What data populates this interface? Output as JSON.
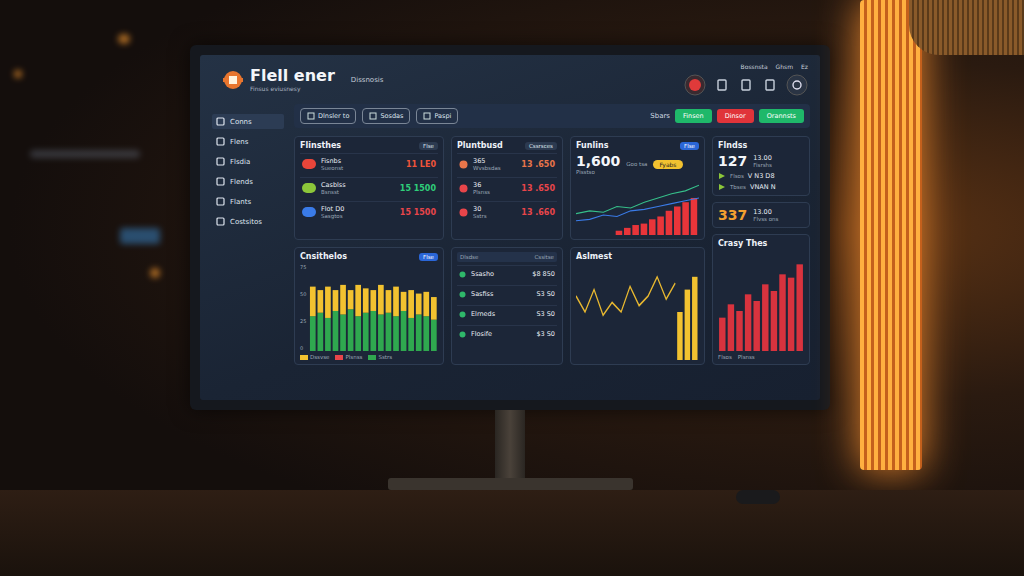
{
  "app": {
    "title": "Flell ener",
    "subtitle": "Finsus eviusnesy",
    "nav": "Dissnosis"
  },
  "top_links": [
    "Bossnsta",
    "Ghsm",
    "Ez"
  ],
  "sidebar": {
    "items": [
      {
        "label": "Conns",
        "selected": true
      },
      {
        "label": "Flens",
        "selected": false
      },
      {
        "label": "Flsdia",
        "selected": false
      },
      {
        "label": "Flends",
        "selected": false
      },
      {
        "label": "Flants",
        "selected": false
      },
      {
        "label": "Costsitos",
        "selected": false
      }
    ]
  },
  "toolbar": {
    "tabs": [
      "Dlnsler to",
      "Sosdas",
      "Paspi"
    ],
    "label": "Sbars",
    "actions": [
      {
        "label": "Finsen",
        "color": "#1fb86a"
      },
      {
        "label": "Dinsor",
        "color": "#e0343a"
      },
      {
        "label": "Orannsts",
        "color": "#1fb86a"
      }
    ]
  },
  "flinsthes": {
    "title": "Flinsthes",
    "badge": "Flse",
    "rows": [
      {
        "name": "Fisnbs",
        "sub": "Sueonst",
        "value": "11 LE0",
        "color": "#f0543a",
        "logo_color": "#e8453a"
      },
      {
        "name": "Casblss",
        "sub": "Bsnsst",
        "value": "15 1500",
        "color": "#2fce7a",
        "logo_color": "#8cc63a"
      },
      {
        "name": "Flot D0",
        "sub": "Sasgtos",
        "value": "15 1500",
        "color": "#e8454a",
        "logo_color": "#3a7be8"
      }
    ]
  },
  "pluntbusd": {
    "title": "Pluntbusd",
    "badge": "Cssrsces",
    "rows": [
      {
        "name": "365",
        "sub": "Wvsbsdas",
        "value": "13 .650",
        "color": "#e8754a"
      },
      {
        "name": "36",
        "sub": "Plsnss",
        "value": "13 .650",
        "color": "#e8454a"
      },
      {
        "name": "30",
        "sub": "Sstrs",
        "value": "13 .660",
        "color": "#e8454a"
      }
    ]
  },
  "funlins": {
    "title": "Funlins",
    "badge": "Flse",
    "value": "1,600",
    "sub": "Pisstso",
    "note": "Goo tsa",
    "pill": "Fyabs",
    "max": 80,
    "line_a": [
      30,
      34,
      32,
      40,
      38,
      46,
      52,
      58,
      62,
      70
    ],
    "line_b": [
      20,
      22,
      28,
      26,
      34,
      36,
      40,
      44,
      48,
      52
    ],
    "bars": [
      6,
      10,
      14,
      16,
      22,
      26,
      34,
      40,
      46,
      52
    ]
  },
  "flndss": {
    "title": "Flndss",
    "value": "127",
    "sub": "13.00",
    "caption": "Fisrshs",
    "rows": [
      {
        "label": "Flsos",
        "value": "V N3 D8"
      },
      {
        "label": "Tbses",
        "value": "VNAN N"
      }
    ]
  },
  "stat": {
    "value": "337",
    "sub": "13.00",
    "caption": "Flvss ons"
  },
  "crasy": {
    "title": "Crasy Thes",
    "max": 60,
    "values": [
      20,
      28,
      24,
      34,
      30,
      40,
      36,
      46,
      44,
      52
    ],
    "legend": [
      "Flsos",
      "Plsnss"
    ]
  },
  "cnsithelos": {
    "title": "Cnsithelos",
    "badge": "Flse",
    "ticks": [
      "75",
      "50",
      "25",
      "0"
    ],
    "max": 100,
    "green": [
      40,
      44,
      38,
      46,
      42,
      48,
      40,
      44,
      46,
      42,
      44,
      40,
      46,
      38,
      42,
      40,
      36
    ],
    "yellow": [
      34,
      26,
      36,
      24,
      34,
      22,
      36,
      28,
      24,
      34,
      26,
      34,
      22,
      32,
      24,
      28,
      26
    ],
    "legend": [
      {
        "label": "Dssvse",
        "color": "#f2c230"
      },
      {
        "label": "Plsnss",
        "color": "#e8454a"
      },
      {
        "label": "Sstrs",
        "color": "#2fa84f"
      }
    ]
  },
  "list": {
    "columns": [
      "Dlsdse",
      "Cssitse"
    ],
    "rows": [
      {
        "name": "Ssasho",
        "value": "$8 850"
      },
      {
        "name": "Sasfiss",
        "value": "S3 S0"
      },
      {
        "name": "Elrneds",
        "value": "S3 S0"
      },
      {
        "name": "Flosife",
        "value": "$3 S0"
      }
    ]
  },
  "aslmest": {
    "title": "Aslmest",
    "max": 60,
    "line": [
      40,
      30,
      44,
      28,
      36,
      30,
      46,
      34,
      40,
      52,
      38,
      48
    ],
    "bars": [
      30,
      44,
      52
    ]
  }
}
